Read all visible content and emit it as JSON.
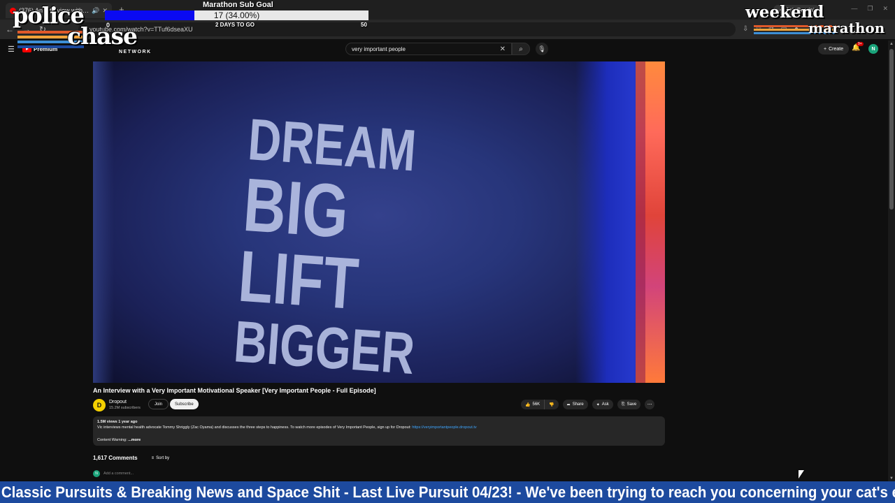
{
  "browser": {
    "tab_title": "(376) An Interview with a V...",
    "url": "youtube.com/watch?v=TTuf6dseaXU",
    "gemini_label": "Ask Gemini"
  },
  "youtube": {
    "logo_text": "Premium",
    "search_value": "very important people",
    "create_label": "Create",
    "notif_badge": "9+",
    "avatar_letter": "N"
  },
  "video": {
    "shirt_text": [
      "DREAM",
      "BIG",
      "LIFT",
      "BIGGER"
    ],
    "title": "An Interview with a Very Important Motivational Speaker [Very Important People - Full Episode]",
    "channel": "Dropout",
    "channel_initial": "D",
    "subscribers": "15.2M subscribers",
    "join_label": "Join",
    "subscribe_label": "Subscribe",
    "likes": "56K",
    "share_label": "Share",
    "ask_label": "Ask",
    "save_label": "Save"
  },
  "description": {
    "stats": "1.5M views  1 year ago",
    "text": "Vic interviews mental health advocate Tommy Shriggly (Zac Oyama) and discusses the three steps to happiness. To watch more episodes of Very Important People, sign up for Dropout: ",
    "link": "https://veryimportantpeople.dropout.tv",
    "warning": "Content Warning:",
    "more": "...more"
  },
  "comments": {
    "count": "1,617 Comments",
    "sort_label": "Sort by",
    "placeholder": "Add a comment..."
  },
  "overlay": {
    "logo_top": "police",
    "logo_bottom": "chase",
    "logo_network": "NETWORK",
    "goal_title": "Marathon Sub Goal",
    "goal_value": "17 (34.00%)",
    "goal_progress": 0.34,
    "goal_min": "0",
    "goal_days": "2 DAYS TO GO",
    "goal_max": "50",
    "marathon_top": "weekend",
    "marathon_bottom": "marathon",
    "ticker": "Classic Pursuits & Breaking News and Space Shit - Last Live Pursuit 04/23! - We've been trying to reach you concerning your cat's extended warranty.",
    "stripe_colors": [
      "#e0592a",
      "#f2a33a",
      "#3d8fd6",
      "#1d4a9e"
    ]
  }
}
